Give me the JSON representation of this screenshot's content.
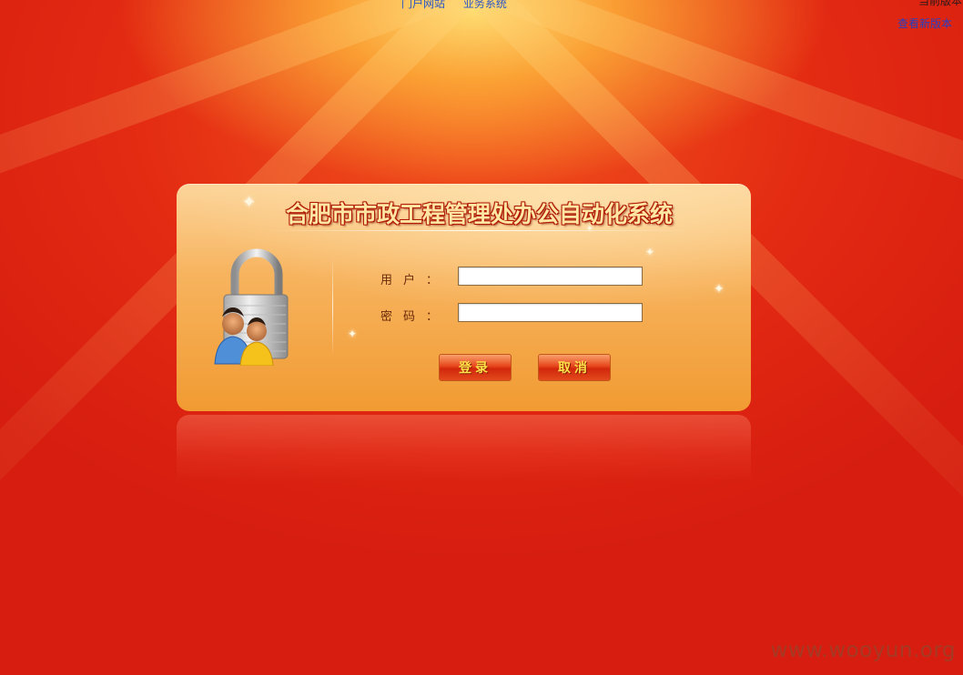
{
  "top_nav": {
    "portal_link": "门户网站",
    "business_link": "业务系统"
  },
  "version": {
    "current_label": "当前版本",
    "new_version_link": "查看新版本"
  },
  "login": {
    "title": "合肥市市政工程管理处办公自动化系统",
    "username_label": "用户：",
    "password_label": "密码：",
    "username_value": "",
    "password_value": "",
    "login_button": "登录",
    "cancel_button": "取消"
  },
  "watermark": "www.wooyun.org",
  "icons": {
    "lock": "padlock-users-icon"
  },
  "colors": {
    "background": "#d9261a",
    "panel": "#f7b35e",
    "title_text": "#ffe7a3",
    "link": "#2a56c6",
    "button": "#e6461b",
    "button_text": "#ffe14a"
  }
}
